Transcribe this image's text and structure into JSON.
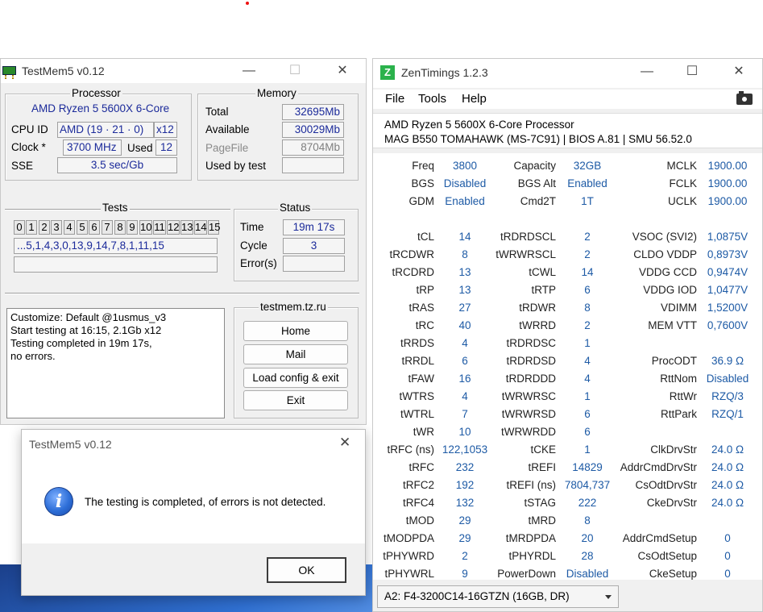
{
  "testmem": {
    "title": "TestMem5 v0.12",
    "processor_heading": "Processor",
    "cpu_name": "AMD Ryzen 5 5600X 6-Core",
    "cpu_id_label": "CPU ID",
    "cpu_id_value": "AMD  (19 · 21 · 0)",
    "cpu_threads": "x12",
    "clock_label": "Clock *",
    "clock_value": "3700 MHz",
    "used_label": "Used",
    "used_value": "12",
    "sse_label": "SSE",
    "sse_value": "3.5 sec/Gb",
    "memory_heading": "Memory",
    "total_label": "Total",
    "total_value": "32695Mb",
    "available_label": "Available",
    "available_value": "30029Mb",
    "pagefile_label": "PageFile",
    "pagefile_value": "8704Mb",
    "usedbytest_label": "Used by test",
    "usedbytest_value": "",
    "tests_heading": "Tests",
    "test_cells": [
      "0",
      "1",
      "2",
      "3",
      "4",
      "5",
      "6",
      "7",
      "8",
      "9",
      "10",
      "11",
      "12",
      "13",
      "14",
      "15"
    ],
    "test_sequence": "...5,1,4,3,0,13,9,14,7,8,1,11,15",
    "status_heading": "Status",
    "time_label": "Time",
    "time_value": "19m 17s",
    "cycle_label": "Cycle",
    "cycle_value": "3",
    "errors_label": "Error(s)",
    "errors_value": "",
    "log_lines": "Customize: Default @1usmus_v3\nStart testing at 16:15, 2.1Gb x12\nTesting completed in 19m 17s,\nno errors.",
    "site_heading": "testmem.tz.ru",
    "btn_home": "Home",
    "btn_mail": "Mail",
    "btn_load": "Load config & exit",
    "btn_exit": "Exit"
  },
  "dialog": {
    "title": "TestMem5 v0.12",
    "message": "The testing is completed, of errors is not detected.",
    "ok_label": "OK"
  },
  "zentimings": {
    "title": "ZenTimings 1.2.3",
    "menu": [
      "File",
      "Tools",
      "Help"
    ],
    "cpu_line": "AMD Ryzen 5 5600X 6-Core Processor",
    "board_line": "MAG B550 TOMAHAWK (MS-7C91) | BIOS A.81 | SMU 56.52.0",
    "col1": [
      [
        "Freq",
        "3800"
      ],
      [
        "BGS",
        "Disabled"
      ],
      [
        "GDM",
        "Enabled"
      ],
      [
        "",
        ""
      ],
      [
        "tCL",
        "14"
      ],
      [
        "tRCDWR",
        "8"
      ],
      [
        "tRCDRD",
        "13"
      ],
      [
        "tRP",
        "13"
      ],
      [
        "tRAS",
        "27"
      ],
      [
        "tRC",
        "40"
      ],
      [
        "tRRDS",
        "4"
      ],
      [
        "tRRDL",
        "6"
      ],
      [
        "tFAW",
        "16"
      ],
      [
        "tWTRS",
        "4"
      ],
      [
        "tWTRL",
        "7"
      ],
      [
        "tWR",
        "10"
      ],
      [
        "tRFC (ns)",
        "122,1053"
      ],
      [
        "tRFC",
        "232"
      ],
      [
        "tRFC2",
        "192"
      ],
      [
        "tRFC4",
        "132"
      ],
      [
        "tMOD",
        "29"
      ],
      [
        "tMODPDA",
        "29"
      ],
      [
        "tPHYWRD",
        "2"
      ],
      [
        "tPHYWRL",
        "9"
      ]
    ],
    "col2": [
      [
        "Capacity",
        "32GB"
      ],
      [
        "BGS Alt",
        "Enabled"
      ],
      [
        "Cmd2T",
        "1T"
      ],
      [
        "",
        ""
      ],
      [
        "tRDRDSCL",
        "2"
      ],
      [
        "tWRWRSCL",
        "2"
      ],
      [
        "tCWL",
        "14"
      ],
      [
        "tRTP",
        "6"
      ],
      [
        "tRDWR",
        "8"
      ],
      [
        "tWRRD",
        "2"
      ],
      [
        "tRDRDSC",
        "1"
      ],
      [
        "tRDRDSD",
        "4"
      ],
      [
        "tRDRDDD",
        "4"
      ],
      [
        "tWRWRSC",
        "1"
      ],
      [
        "tWRWRSD",
        "6"
      ],
      [
        "tWRWRDD",
        "6"
      ],
      [
        "tCKE",
        "1"
      ],
      [
        "tREFI",
        "14829"
      ],
      [
        "tREFI (ns)",
        "7804,737"
      ],
      [
        "tSTAG",
        "222"
      ],
      [
        "tMRD",
        "8"
      ],
      [
        "tMRDPDA",
        "20"
      ],
      [
        "tPHYRDL",
        "28"
      ],
      [
        "PowerDown",
        "Disabled"
      ]
    ],
    "col3": [
      [
        "MCLK",
        "1900.00"
      ],
      [
        "FCLK",
        "1900.00"
      ],
      [
        "UCLK",
        "1900.00"
      ],
      [
        "",
        ""
      ],
      [
        "VSOC (SVI2)",
        "1,0875V"
      ],
      [
        "CLDO VDDP",
        "0,8973V"
      ],
      [
        "VDDG CCD",
        "0,9474V"
      ],
      [
        "VDDG IOD",
        "1,0477V"
      ],
      [
        "VDIMM",
        "1,5200V"
      ],
      [
        "MEM VTT",
        "0,7600V"
      ],
      [
        "",
        ""
      ],
      [
        "ProcODT",
        "36.9 Ω"
      ],
      [
        "RttNom",
        "Disabled"
      ],
      [
        "RttWr",
        "RZQ/3"
      ],
      [
        "RttPark",
        "RZQ/1"
      ],
      [
        "",
        ""
      ],
      [
        "ClkDrvStr",
        "24.0 Ω"
      ],
      [
        "AddrCmdDrvStr",
        "24.0 Ω"
      ],
      [
        "CsOdtDrvStr",
        "24.0 Ω"
      ],
      [
        "CkeDrvStr",
        "24.0 Ω"
      ],
      [
        "",
        ""
      ],
      [
        "AddrCmdSetup",
        "0"
      ],
      [
        "CsOdtSetup",
        "0"
      ],
      [
        "CkeSetup",
        "0"
      ]
    ],
    "dimm_select": "A2: F4-3200C14-16GTZN (16GB, DR)"
  }
}
